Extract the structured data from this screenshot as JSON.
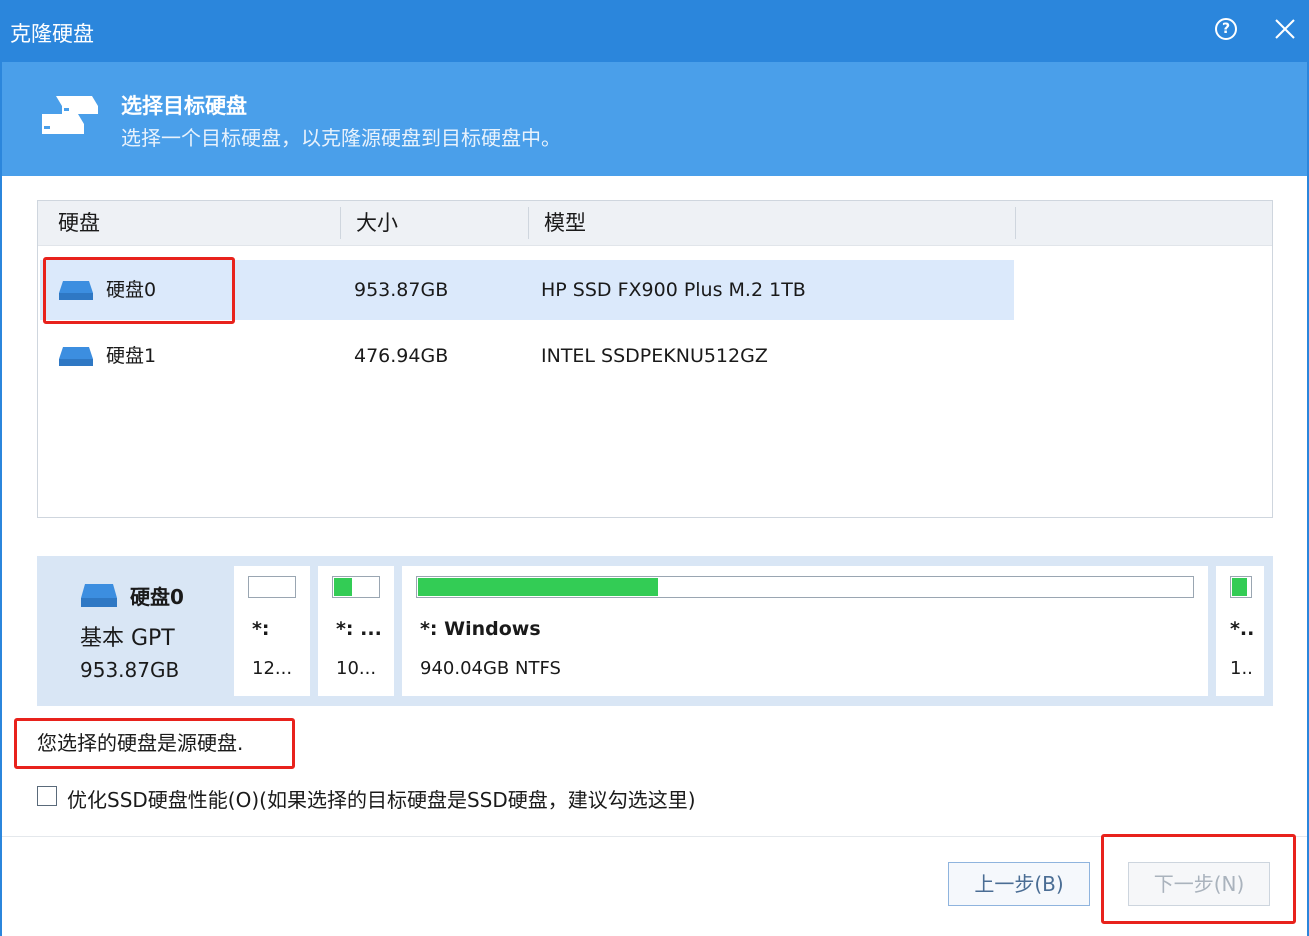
{
  "window": {
    "title": "克隆硬盘"
  },
  "banner": {
    "title": "选择目标硬盘",
    "subtitle": "选择一个目标硬盘，以克隆源硬盘到目标硬盘中。"
  },
  "disk_list": {
    "columns": [
      "硬盘",
      "大小",
      "模型"
    ],
    "rows": [
      {
        "name": "硬盘0",
        "size": "953.87GB",
        "model": "HP SSD FX900 Plus M.2 1TB",
        "selected": true
      },
      {
        "name": "硬盘1",
        "size": "476.94GB",
        "model": "INTEL SSDPEKNU512GZ",
        "selected": false
      }
    ]
  },
  "disk_map": {
    "name": "硬盘0",
    "type": "基本 GPT",
    "size": "953.87GB",
    "partitions": [
      {
        "label": "*:",
        "size": "12...",
        "used_fraction": 0.0
      },
      {
        "label": "*: ...",
        "size": "10...",
        "used_fraction": 0.4
      },
      {
        "label": "*: Windows",
        "size": "940.04GB NTFS",
        "used_fraction": 0.31
      },
      {
        "label": "*..",
        "size": "1..",
        "used_fraction": 0.85
      }
    ]
  },
  "message": "您选择的硬盘是源硬盘.",
  "option": {
    "label": "优化SSD硬盘性能(O)(如果选择的目标硬盘是SSD硬盘，建议勾选这里)",
    "checked": false
  },
  "buttons": {
    "back": "上一步(B)",
    "next": "下一步(N)"
  },
  "colors": {
    "title_bar": "#2b86dc",
    "banner": "#4a9fea",
    "selection": "#dbe9fb",
    "used_space": "#33cc55",
    "highlight_box": "#e8221c"
  },
  "icons": {
    "help": "help-icon",
    "close": "close-icon",
    "banner": "disk-stack-icon",
    "disk": "disk-icon"
  }
}
